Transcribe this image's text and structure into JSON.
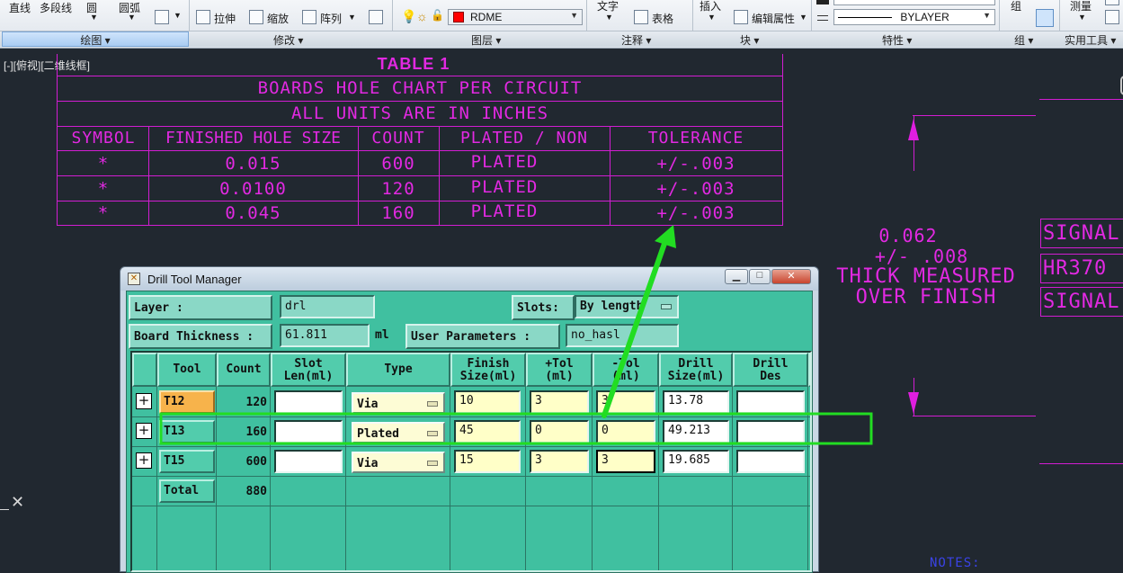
{
  "ribbon": {
    "top_items": [
      "直线",
      "多段线",
      "圆",
      "圆弧"
    ],
    "modify": {
      "stretch": "拉伸",
      "scale": "缩放",
      "array": "阵列"
    },
    "layer_name": "RDME",
    "annotation": {
      "text": "文字",
      "table": "表格"
    },
    "block": {
      "insert": "插入",
      "edit_attr": "编辑属性"
    },
    "properties": {
      "linetype": "BYLAYER"
    },
    "group": "组",
    "measure": "测量",
    "panels": [
      "绘图",
      "修改",
      "图层",
      "注释",
      "块",
      "特性",
      "组",
      "实用工具"
    ]
  },
  "viewport": {
    "label": "[-][俯视][二维线框]"
  },
  "cad_table": {
    "title": "TABLE 1",
    "header1": "BOARDS HOLE CHART PER CIRCUIT",
    "header2": "ALL UNITS ARE IN INCHES",
    "columns": [
      "SYMBOL",
      "FINISHED HOLE SIZE",
      "COUNT",
      "PLATED / NON",
      "TOLERANCE"
    ],
    "rows": [
      [
        "*",
        "0.015",
        "600",
        "PLATED",
        "+/-.003"
      ],
      [
        "*",
        "0.0100",
        "120",
        "PLATED",
        "+/-.003"
      ],
      [
        "*",
        "0.045",
        "160",
        "PLATED",
        "+/-.003"
      ]
    ]
  },
  "drawing_text": {
    "dim1": "0.062",
    "dim2": "+/-  .008",
    "dim3": "THICK MEASURED",
    "dim4": "OVER FINISH",
    "boxes": [
      "SIGNAL",
      "HR370",
      "SIGNAL"
    ],
    "notes": "NOTES:"
  },
  "dialog": {
    "title": "Drill Tool Manager",
    "layer_label": "Layer          :",
    "layer_value": "drl",
    "slots_label": "Slots:",
    "slots_value": "By length",
    "thickness_label": "Board Thickness :",
    "thickness_value": "61.811",
    "thickness_unit": "ml",
    "user_params_label": "User Parameters :",
    "user_params_value": "no_hasl",
    "columns": [
      {
        "l1": "",
        "l2": ""
      },
      {
        "l1": "Tool",
        "l2": ""
      },
      {
        "l1": "Count",
        "l2": ""
      },
      {
        "l1": "Slot",
        "l2": "Len(ml)"
      },
      {
        "l1": "Type",
        "l2": ""
      },
      {
        "l1": "Finish",
        "l2": "Size(ml)"
      },
      {
        "l1": "+Tol",
        "l2": "(ml)"
      },
      {
        "l1": "-Tol",
        "l2": "(ml)"
      },
      {
        "l1": "Drill",
        "l2": "Size(ml)"
      },
      {
        "l1": "Drill",
        "l2": "Des"
      }
    ],
    "rows": [
      {
        "tool": "T12",
        "count": "120",
        "slot": "",
        "type": "Via",
        "finish": "10",
        "ptol": "3",
        "ntol": "3",
        "drill": "13.78",
        "des": ""
      },
      {
        "tool": "T13",
        "count": "160",
        "slot": "",
        "type": "Plated",
        "finish": "45",
        "ptol": "0",
        "ntol": "0",
        "drill": "49.213",
        "des": ""
      },
      {
        "tool": "T15",
        "count": "600",
        "slot": "",
        "type": "Via",
        "finish": "15",
        "ptol": "3",
        "ntol": "3",
        "drill": "19.685",
        "des": ""
      }
    ],
    "total_label": "Total",
    "total_value": "880"
  },
  "colors": {
    "cad_magenta": "#e01ee0",
    "dialog_teal": "#40c0a0",
    "highlight_green": "#22dd22",
    "tool_selected": "#f7b34b"
  }
}
